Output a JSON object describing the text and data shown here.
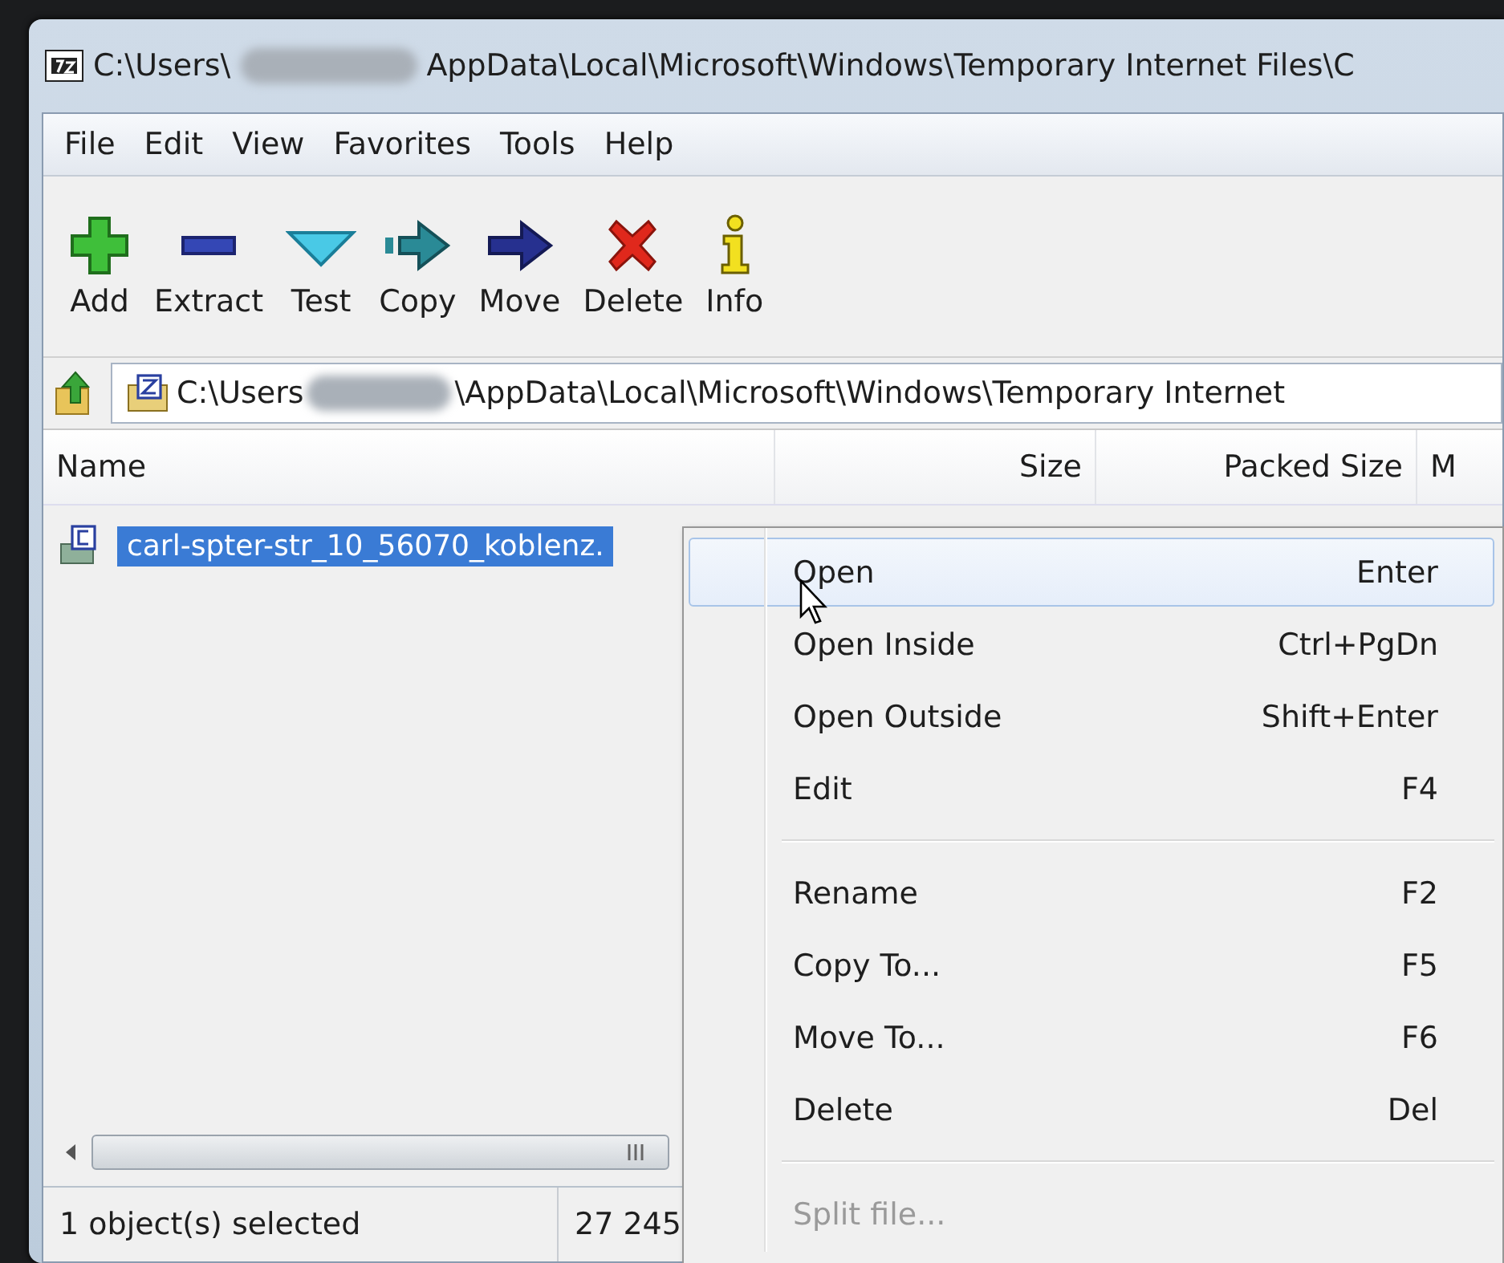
{
  "window": {
    "title_start": "C:\\Users\\",
    "title_end": "AppData\\Local\\Microsoft\\Windows\\Temporary Internet Files\\C"
  },
  "menu": [
    "File",
    "Edit",
    "View",
    "Favorites",
    "Tools",
    "Help"
  ],
  "toolbar": [
    {
      "label": "Add",
      "kind": "add"
    },
    {
      "label": "Extract",
      "kind": "extract"
    },
    {
      "label": "Test",
      "kind": "test"
    },
    {
      "label": "Copy",
      "kind": "copy"
    },
    {
      "label": "Move",
      "kind": "move"
    },
    {
      "label": "Delete",
      "kind": "delete"
    },
    {
      "label": "Info",
      "kind": "info"
    }
  ],
  "address": {
    "start": "C:\\Users",
    "end": "\\AppData\\Local\\Microsoft\\Windows\\Temporary Internet"
  },
  "columns": [
    "Name",
    "Size",
    "Packed Size",
    "M"
  ],
  "files": [
    {
      "name": "carl-spter-str_10_56070_koblenz.",
      "selected": true
    }
  ],
  "status": [
    "1 object(s) selected",
    "27 245"
  ],
  "context_menu": [
    {
      "kind": "item",
      "label": "Open",
      "shortcut": "Enter",
      "selected": true,
      "disabled": false
    },
    {
      "kind": "item",
      "label": "Open Inside",
      "shortcut": "Ctrl+PgDn",
      "selected": false,
      "disabled": false
    },
    {
      "kind": "item",
      "label": "Open Outside",
      "shortcut": "Shift+Enter",
      "selected": false,
      "disabled": false
    },
    {
      "kind": "item",
      "label": "Edit",
      "shortcut": "F4",
      "selected": false,
      "disabled": false
    },
    {
      "kind": "separator"
    },
    {
      "kind": "item",
      "label": "Rename",
      "shortcut": "F2",
      "selected": false,
      "disabled": false
    },
    {
      "kind": "item",
      "label": "Copy To...",
      "shortcut": "F5",
      "selected": false,
      "disabled": false
    },
    {
      "kind": "item",
      "label": "Move To...",
      "shortcut": "F6",
      "selected": false,
      "disabled": false
    },
    {
      "kind": "item",
      "label": "Delete",
      "shortcut": "Del",
      "selected": false,
      "disabled": false
    },
    {
      "kind": "separator"
    },
    {
      "kind": "item",
      "label": "Split file...",
      "selected": false,
      "disabled": true
    }
  ]
}
